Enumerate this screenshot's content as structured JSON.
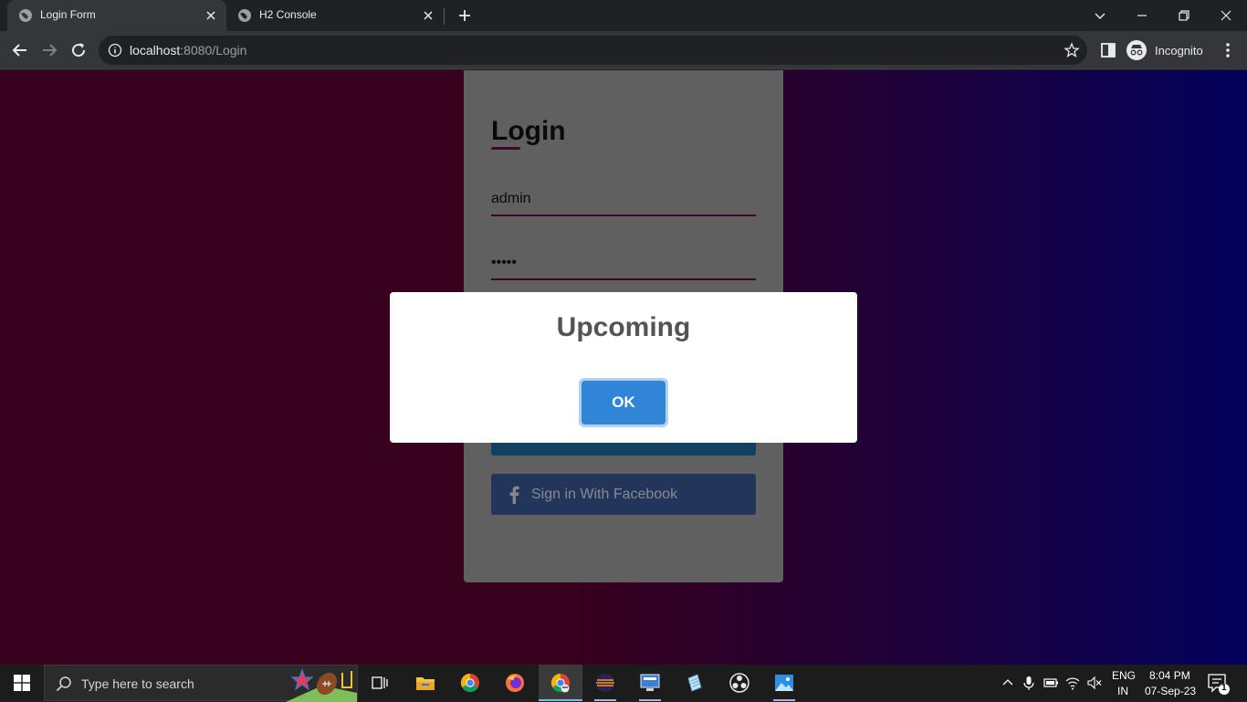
{
  "browser": {
    "tabs": [
      {
        "title": "Login Form",
        "active": true
      },
      {
        "title": "H2 Console",
        "active": false
      }
    ],
    "url_host": "localhost",
    "url_rest": ":8080/Login",
    "incognito_label": "Incognito"
  },
  "login": {
    "title": "Login",
    "username_value": "admin",
    "password_value": "admin",
    "facebook_label": "Sign in With Facebook"
  },
  "modal": {
    "title": "Upcoming",
    "ok_label": "OK"
  },
  "taskbar": {
    "search_placeholder": "Type here to search",
    "language_top": "ENG",
    "language_bottom": "IN",
    "time": "8:04 PM",
    "date": "07-Sep-23",
    "notification_count": "1"
  },
  "colors": {
    "accent": "#6a0b3e",
    "facebook": "#3b5998",
    "modal_button": "#3085d6"
  }
}
